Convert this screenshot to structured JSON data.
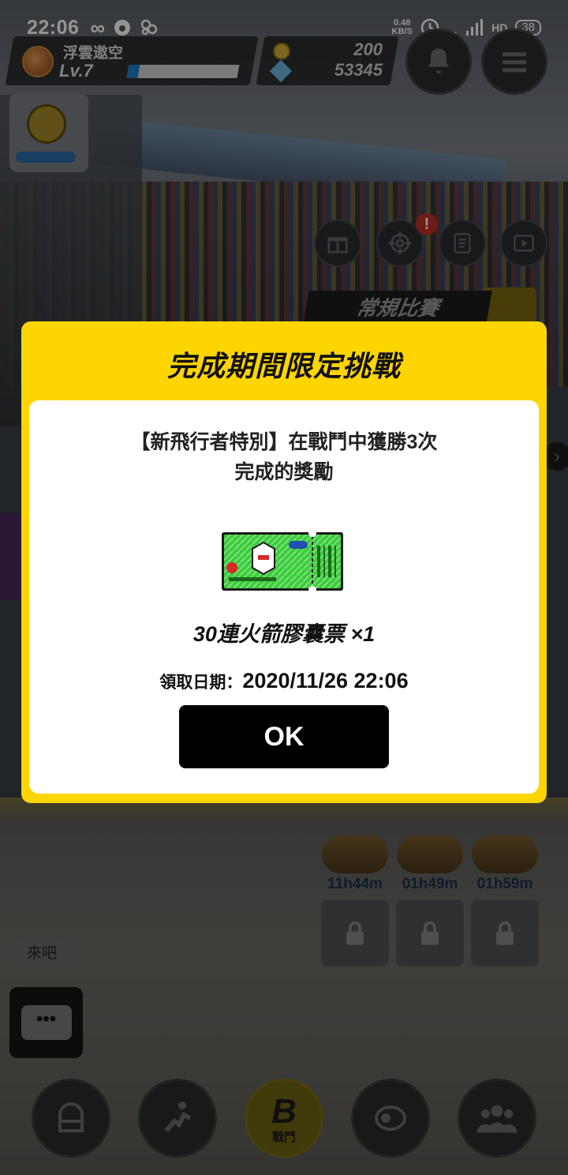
{
  "status_bar": {
    "time": "22:06",
    "net_speed_value": "0.48",
    "net_speed_unit": "KB/S",
    "network": "46",
    "hd": "HD",
    "battery": "38"
  },
  "player": {
    "name": "浮雲遨空",
    "level": "Lv.7",
    "xp_fraction": 0.1
  },
  "currency": {
    "coins": "200",
    "gems": "53345"
  },
  "mode_banner": "常規比賽",
  "alert_badge": "!",
  "capsules": [
    {
      "timer": "11h44m"
    },
    {
      "timer": "01h49m"
    },
    {
      "timer": "01h59m"
    }
  ],
  "chat": {
    "bubble_text": "來吧",
    "button_glyph": "•••"
  },
  "bottom_nav": {
    "battle_label": "戰鬥",
    "battle_glyph": "B"
  },
  "modal": {
    "title": "完成期間限定挑戰",
    "description_line1": "【新飛行者特別】在戰鬥中獲勝3次",
    "description_line2": "完成的獎勵",
    "reward_name": "30連火箭膠囊票 ×1",
    "claim_date_label": "領取日期：",
    "claim_date_value": "2020/11/26 22:06",
    "ok_label": "OK"
  },
  "colors": {
    "modal_yellow": "#ffd500",
    "ok_button": "#000000",
    "ticket_green": "#3ccb3c"
  }
}
